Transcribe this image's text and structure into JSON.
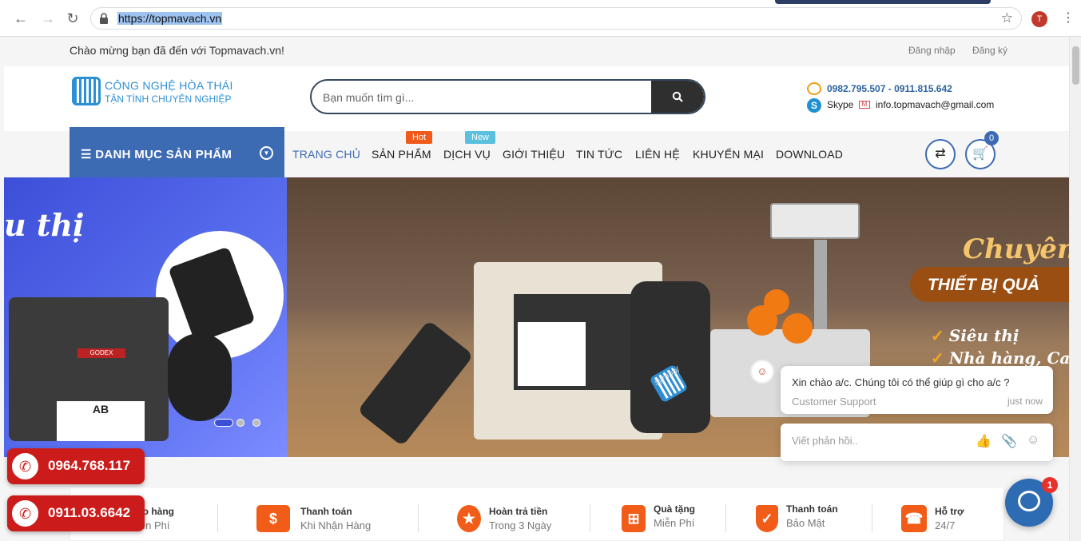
{
  "browser": {
    "url": "https://topmavach.vn",
    "profile_initial": "T"
  },
  "topbar": {
    "greeting": "Chào mừng bạn đã đến với Topmavach.vn!",
    "login": "Đăng nhập",
    "register": "Đăng ký"
  },
  "header": {
    "logo_line1": "CÔNG NGHỆ HÒA THÁI",
    "logo_line2": "TẬN TÌNH CHUYÊN NGHIỆP",
    "search_placeholder": "Bạn muốn tìm gì...",
    "phones": "0982.795.507 - 0911.815.642",
    "skype": "Skype",
    "email": "info.topmavach@gmail.com"
  },
  "nav": {
    "category_label": "DANH MỤC SẢN PHẨM",
    "items": [
      "TRANG CHỦ",
      "SẢN PHẨM",
      "DỊCH VỤ",
      "GIỚI THIỆU",
      "TIN TỨC",
      "LIÊN HỆ",
      "KHUYẾN MẠI",
      "DOWNLOAD"
    ],
    "hot_tag": "Hot",
    "new_tag": "New",
    "cart_count": "0"
  },
  "banner_left": {
    "headline": "u thị",
    "label_ab": "AB"
  },
  "banner_main": {
    "title": "Chuyên",
    "ribbon": "THIẾT BỊ QUẢ",
    "bullets": [
      "Siêu thị",
      "Nhà hàng, Cafe"
    ],
    "scanner_brand": "symbol"
  },
  "features": [
    {
      "title": "ao hàng",
      "subtitle": "iễn Phí",
      "icon": "truck-icon"
    },
    {
      "title": "Thanh toán",
      "subtitle": "Khi Nhận Hàng",
      "icon": "dollar-icon"
    },
    {
      "title": "Hoàn trả tiền",
      "subtitle": "Trong 3 Ngày",
      "icon": "medal-icon"
    },
    {
      "title": "Quà tặng",
      "subtitle": "Miễn Phí",
      "icon": "gift-icon"
    },
    {
      "title": "Thanh toán",
      "subtitle": "Bảo Mật",
      "icon": "shield-icon"
    },
    {
      "title": "Hỗ trợ",
      "subtitle": "24/7",
      "icon": "phone-icon"
    }
  ],
  "hotlines": [
    "0964.768.117",
    "0911.03.6642"
  ],
  "chat": {
    "message": "Xin chào a/c. Chúng tôi có thể giúp gì cho a/c ?",
    "sender": "Customer Support",
    "time": "just now",
    "reply_placeholder": "Viết phản hồi..",
    "unread": "1"
  },
  "colors": {
    "primary": "#3d6bb3",
    "accent": "#f25c19",
    "hotline": "#cc1b1b"
  }
}
